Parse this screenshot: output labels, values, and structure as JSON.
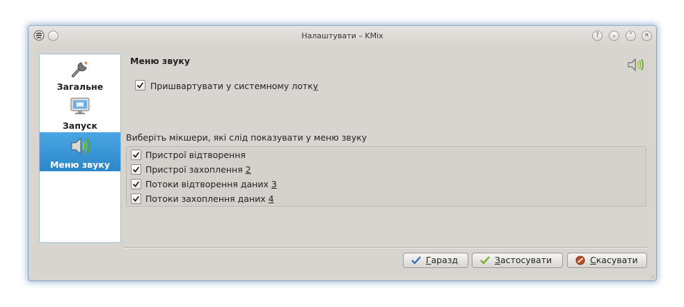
{
  "window": {
    "title": "Налаштувати – KMix",
    "buttons": [
      "?",
      "⌄",
      "⌃",
      "✕"
    ]
  },
  "sidebar": {
    "items": [
      {
        "label": "Загальне",
        "icon": "wrench-icon",
        "selected": false
      },
      {
        "label": "Запуск",
        "icon": "monitor-icon",
        "selected": false
      },
      {
        "label": "Меню звуку",
        "icon": "speaker-icon",
        "selected": true
      }
    ]
  },
  "page": {
    "title": "Меню звуку",
    "dock_checkbox": {
      "label_pre": "Пришвартувати у системному лотк",
      "label_accel": "у",
      "checked": true
    },
    "mixers_label": "Виберіть мікшери, які слід показувати у меню звуку",
    "mixers": [
      {
        "label_pre": "Пристрої відтворення",
        "accel": "",
        "checked": true
      },
      {
        "label_pre": "Пристрої захоплення ",
        "accel": "2",
        "checked": true
      },
      {
        "label_pre": "Потоки відтворення даних ",
        "accel": "3",
        "checked": true
      },
      {
        "label_pre": "Потоки захоплення даних ",
        "accel": "4",
        "checked": true
      }
    ]
  },
  "buttons": {
    "ok": {
      "accel": "Г",
      "rest": "аразд"
    },
    "apply": {
      "accel": "З",
      "rest": "астосувати"
    },
    "cancel": {
      "accel": "С",
      "rest": "касувати"
    }
  },
  "colors": {
    "selection": "#2b87c9",
    "window_border": "#8aa6bd",
    "background": "#d8d5d0"
  }
}
